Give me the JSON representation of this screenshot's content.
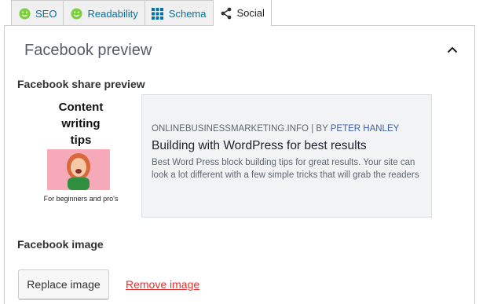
{
  "tabs": [
    {
      "label": "SEO",
      "icon": "smiley-icon",
      "color": "#7ad03a"
    },
    {
      "label": "Readability",
      "icon": "smiley-icon",
      "color": "#7ad03a"
    },
    {
      "label": "Schema",
      "icon": "grid-icon",
      "color": "#0073aa"
    },
    {
      "label": "Social",
      "icon": "share-icon",
      "active": true
    }
  ],
  "panel": {
    "title": "Facebook preview",
    "collapse_icon": "chevron-up-icon"
  },
  "share_preview": {
    "label": "Facebook share preview",
    "image_title": "Content writing tips",
    "image_caption": "For beginners and pro's",
    "source": "ONLINEBUSINESSMARKETING.INFO",
    "separator": " | BY ",
    "author": "PETER HANLEY",
    "title": "Building with WordPress for best results",
    "description": "Best Word Press block building tips for great results. Your site can look a lot different with a few simple tricks that will grab the readers"
  },
  "facebook_image": {
    "label": "Facebook image",
    "replace_label": "Replace image",
    "remove_label": "Remove image"
  },
  "colors": {
    "link": "#0073aa",
    "remove": "#dc3232",
    "card_bg": "#f2f3f5",
    "author": "#4060b0"
  }
}
